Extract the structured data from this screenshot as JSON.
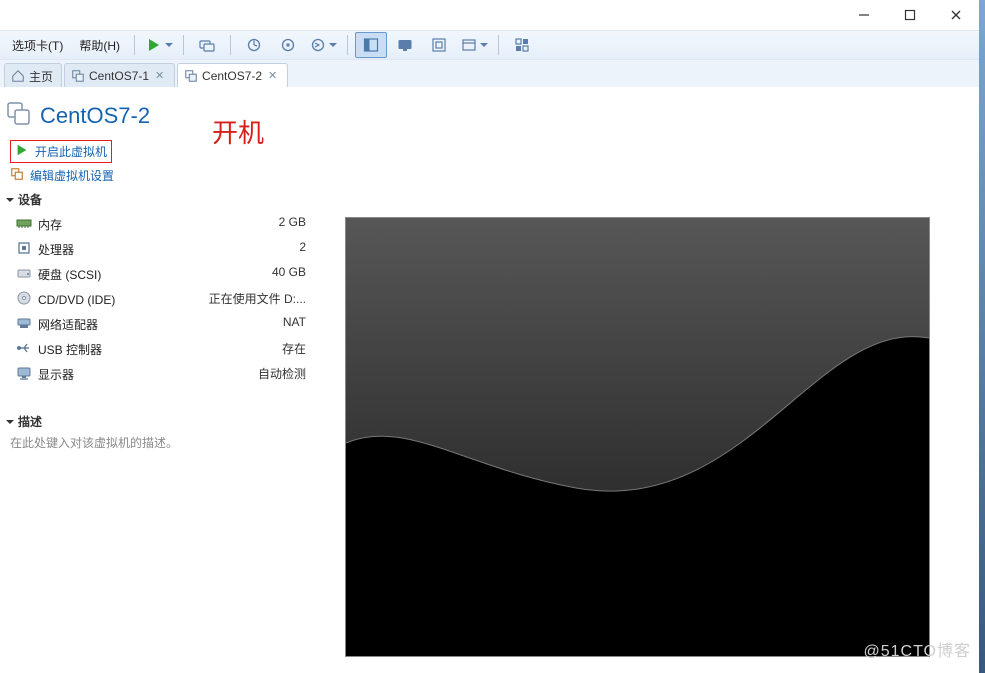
{
  "window_controls": {
    "minimize": "—",
    "maximize": "□",
    "close": "✕"
  },
  "menu": {
    "tabs_card": "选项卡(T)",
    "help": "帮助(H)"
  },
  "toolbar": {
    "play": "play-icon",
    "dropdown": "chevron-down-icon",
    "send_cad": "send-cad-icon",
    "snapshot": "snapshot-icon",
    "snapshot_manage": "snapshot-manage-icon",
    "revert": "revert-icon",
    "revert_dropdown": "chevron-down-icon",
    "view_side": "view-side-icon",
    "view_console": "view-console-icon",
    "fullscreen": "fullscreen-icon",
    "unity": "unity-icon",
    "thumbnails": "thumbnails-icon"
  },
  "tabs": [
    {
      "label": "主页",
      "kind": "home",
      "closable": false,
      "active": false
    },
    {
      "label": "CentOS7-1",
      "kind": "vm",
      "closable": true,
      "active": false
    },
    {
      "label": "CentOS7-2",
      "kind": "vm",
      "closable": true,
      "active": true
    }
  ],
  "vm": {
    "title": "CentOS7-2",
    "actions": {
      "power_on": "开启此虚拟机",
      "edit_settings": "编辑虚拟机设置"
    },
    "annotation": "开机",
    "devices_heading": "设备",
    "devices": [
      {
        "icon": "memory-icon",
        "name": "内存",
        "value": "2 GB"
      },
      {
        "icon": "cpu-icon",
        "name": "处理器",
        "value": "2"
      },
      {
        "icon": "hdd-icon",
        "name": "硬盘 (SCSI)",
        "value": "40 GB"
      },
      {
        "icon": "disc-icon",
        "name": "CD/DVD (IDE)",
        "value": "正在使用文件 D:..."
      },
      {
        "icon": "nic-icon",
        "name": "网络适配器",
        "value": "NAT"
      },
      {
        "icon": "usb-icon",
        "name": "USB 控制器",
        "value": "存在"
      },
      {
        "icon": "display-icon",
        "name": "显示器",
        "value": "自动检测"
      }
    ],
    "description_heading": "描述",
    "description_placeholder": "在此处键入对该虚拟机的描述。"
  },
  "watermark": "@51CTO博客"
}
